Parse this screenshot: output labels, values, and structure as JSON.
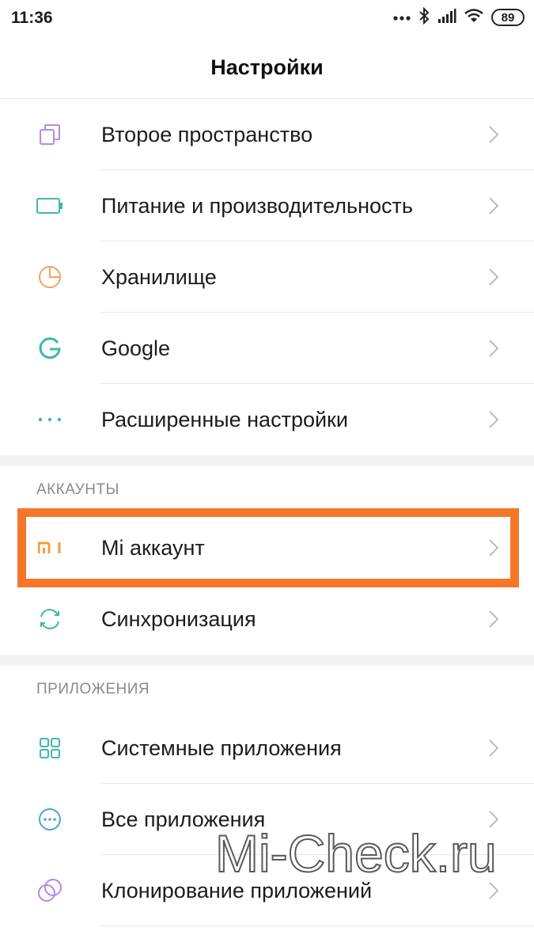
{
  "status_bar": {
    "time": "11:36",
    "battery": "89",
    "icons": [
      "more-dots-icon",
      "bluetooth-icon",
      "signal-icon",
      "wifi-icon",
      "battery-icon"
    ]
  },
  "header": {
    "title": "Настройки"
  },
  "group1": {
    "items": [
      {
        "label": "Второе пространство",
        "icon": "second-space-icon",
        "color": "#b48ae6"
      },
      {
        "label": "Питание и производительность",
        "icon": "battery-outline-icon",
        "color": "#3fb8a6"
      },
      {
        "label": "Хранилище",
        "icon": "pie-chart-icon",
        "color": "#f0a265"
      },
      {
        "label": "Google",
        "icon": "google-icon",
        "color": "#3fb8a6"
      },
      {
        "label": "Расширенные настройки",
        "icon": "more-horizontal-icon",
        "color": "#4aa6d8"
      }
    ]
  },
  "accounts": {
    "header": "АККАУНТЫ",
    "items": [
      {
        "label": "Mi аккаунт",
        "icon": "mi-logo-icon",
        "color": "#f59a3c"
      },
      {
        "label": "Синхронизация",
        "icon": "sync-icon",
        "color": "#3fb8a6"
      }
    ]
  },
  "apps": {
    "header": "ПРИЛОЖЕНИЯ",
    "items": [
      {
        "label": "Системные приложения",
        "icon": "grid-apps-icon",
        "color": "#3fb8a6"
      },
      {
        "label": "Все приложения",
        "icon": "all-apps-icon",
        "color": "#4aa6d8"
      },
      {
        "label": "Клонирование приложений",
        "icon": "dual-apps-icon",
        "color": "#b48ae6"
      }
    ]
  },
  "highlight_color": "#f5782a",
  "watermark": "Mi-Check.ru"
}
